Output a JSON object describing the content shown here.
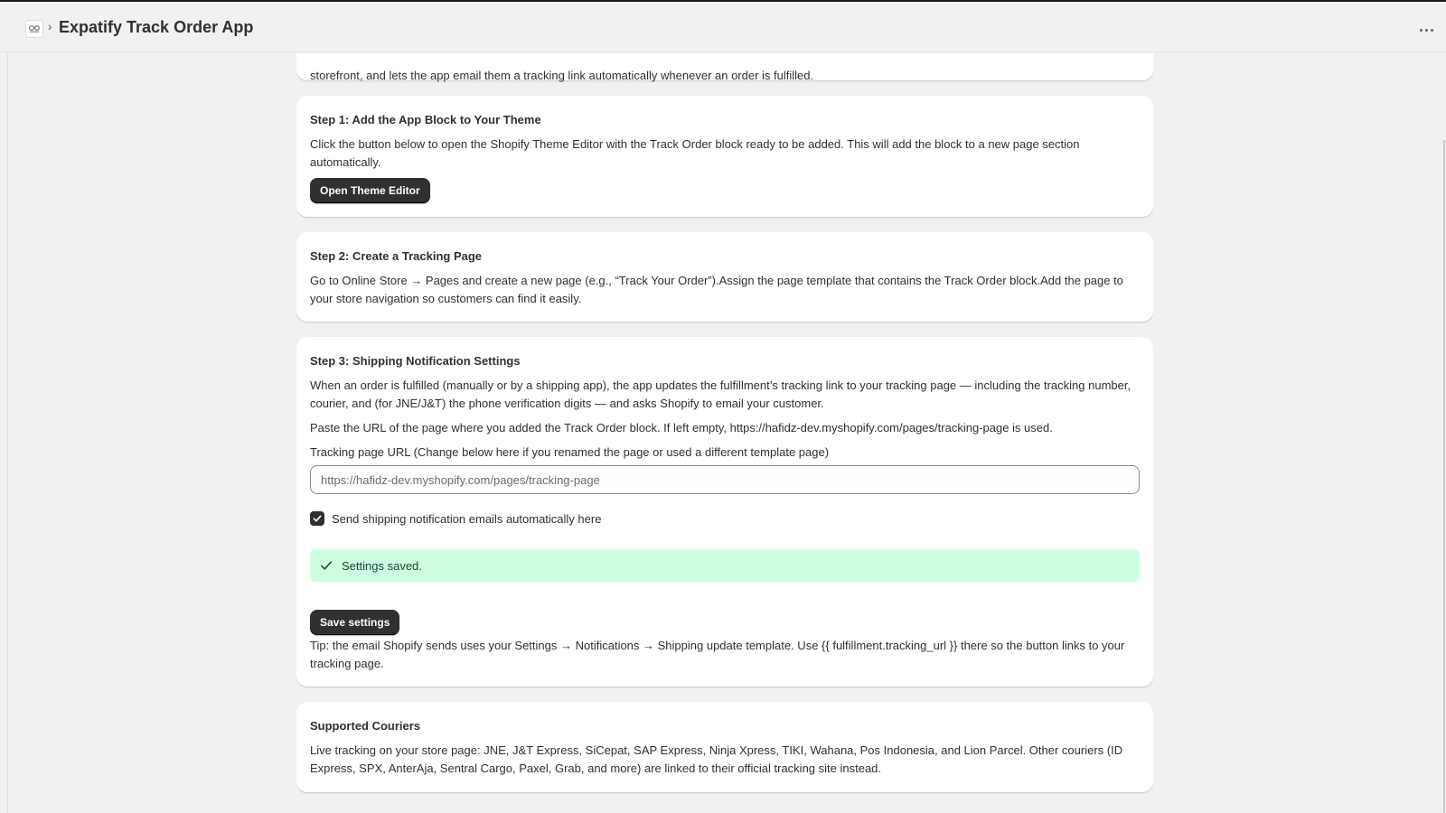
{
  "header": {
    "app_title": "Expatify Track Order App",
    "icons": {
      "app": "app-logo-icon",
      "separator": "chevron-right-icon",
      "more": "more-horizontal-icon"
    }
  },
  "intro": {
    "text": "storefront, and lets the app email them a tracking link automatically whenever an order is fulfilled."
  },
  "step1": {
    "title": "Step 1: Add the App Block to Your Theme",
    "body": "Click the button below to open the Shopify Theme Editor with the Track Order block ready to be added. This will add the block to a new page section automatically.",
    "button_label": "Open Theme Editor"
  },
  "step2": {
    "title": "Step 2: Create a Tracking Page",
    "body": "Go to Online Store → Pages and create a new page (e.g., “Track Your Order”).Assign the page template that contains the Track Order block.Add the page to your store navigation so customers can find it easily."
  },
  "step3": {
    "title": "Step 3: Shipping Notification Settings",
    "body1": "When an order is fulfilled (manually or by a shipping app), the app updates the fulfillment’s tracking link to your tracking page — including the tracking number, courier, and (for JNE/J&T) the phone verification digits — and asks Shopify to email your customer.",
    "body2": "Paste the URL of the page where you added the Track Order block. If left empty, https://hafidz-dev.myshopify.com/pages/tracking-page is used.",
    "field_label": "Tracking page URL (Change below here if you renamed the page or used a different template page)",
    "url_value": "",
    "url_placeholder": "https://hafidz-dev.myshopify.com/pages/tracking-page",
    "checkbox_label": "Send shipping notification emails automatically here",
    "checkbox_checked": true,
    "success_message": "Settings saved.",
    "save_label": "Save settings",
    "tip": "Tip: the email Shopify sends uses your Settings → Notifications → Shipping update template. Use {{ fulfillment.tracking_url }} there so the button links to your tracking page."
  },
  "couriers": {
    "title": "Supported Couriers",
    "body": "Live tracking on your store page: JNE, J&T Express, SiCepat, SAP Express, Ninja Xpress, TIKI, Wahana, Pos Indonesia, and Lion Parcel. Other couriers (ID Express, SPX, AnterAja, Sentral Cargo, Paxel, Grab, and more) are linked to their official tracking site instead."
  },
  "colors": {
    "background": "#f1f1f1",
    "card": "#ffffff",
    "primary_button": "#303030",
    "success_banner": "#cdfee1",
    "success_text": "#0c5132"
  }
}
